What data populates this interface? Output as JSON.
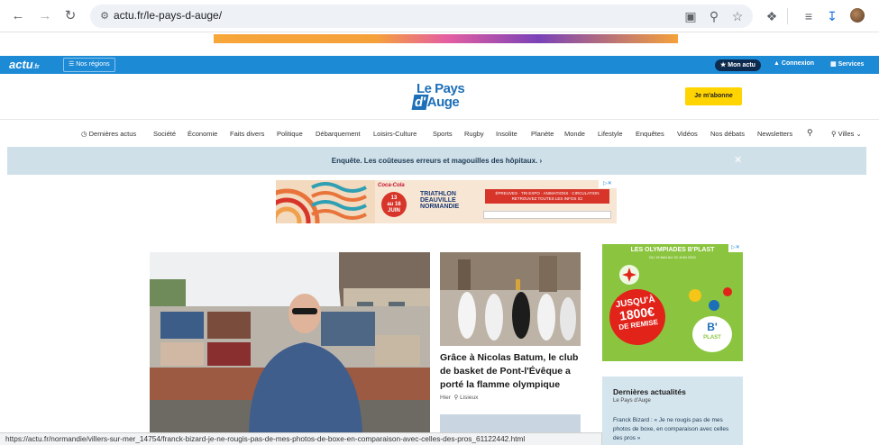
{
  "browser": {
    "url": "actu.fr/le-pays-d-auge/",
    "back_icon": "arrow-left-icon",
    "forward_icon": "arrow-right-icon",
    "reload_icon": "reload-icon"
  },
  "topbar": {
    "logo_text": "actu",
    "logo_suffix": ".fr",
    "regions_label": "Nos régions",
    "mon_actu_label": "Mon actu",
    "connexion_label": "Connexion",
    "services_label": "Services"
  },
  "header": {
    "logo_line1": "Le Pays",
    "logo_d": "d'",
    "logo_line2": "Auge",
    "subscribe_label": "Je m'abonne"
  },
  "nav": {
    "items": [
      "Dernières actus",
      "Société",
      "Économie",
      "Faits divers",
      "Politique",
      "Débarquement",
      "Loisirs-Culture",
      "Sports",
      "Rugby",
      "Insolite",
      "Planète",
      "Monde",
      "Lifestyle",
      "Enquêtes",
      "Vidéos",
      "Nos débats",
      "Newsletters"
    ],
    "villes_label": "Villes"
  },
  "breaking": {
    "text": "Enquête. Les coûteuses erreurs et magouilles des hôpitaux. ›"
  },
  "ad_triathlon": {
    "brand": "Coca-Cola",
    "date_from": "13",
    "date_to": "au 16",
    "date_month": "JUIN",
    "title_1": "TRIATHLON",
    "title_2": "DEAUVILLE",
    "title_3": "NORMANDIE",
    "info_1": "ÉPREUVES · TRI EXPO · ANIMATIONS · CIRCULATION",
    "info_2": "RETROUVEZ TOUTES LES INFOS ICI"
  },
  "articles": [
    {
      "title": "Grâce à Nicolas Batum, le club de basket de Pont-l'Évêque a porté la flamme olympique",
      "date": "Hier",
      "location": "Lisieux"
    }
  ],
  "ad_plast": {
    "title": "LES OLYMPIADES B'PLAST",
    "subtitle": "DU 15 MAI AU 15 JUIN 2024",
    "badge_1": "JUSQU'À",
    "badge_2": "1800€",
    "badge_3": "DE REMISE",
    "logo": "B'",
    "logo_sub": "PLAST"
  },
  "latest": {
    "title": "Dernières actualités",
    "subtitle": "Le Pays d'Auge",
    "item": "Franck Bizard : « Je ne rougis pas de mes photos de boxe, en comparaison avec celles des pros »"
  },
  "status_url": "https://actu.fr/normandie/villers-sur-mer_14754/franck-bizard-je-ne-rougis-pas-de-mes-photos-de-boxe-en-comparaison-avec-celles-des-pros_61122442.html",
  "colors": {
    "actu_blue": "#1d8ad6",
    "logo_blue": "#1d6fb8",
    "subscribe_yellow": "#ffd400",
    "banner_bg": "#cfe0e9",
    "plast_green": "#8bc53f"
  }
}
